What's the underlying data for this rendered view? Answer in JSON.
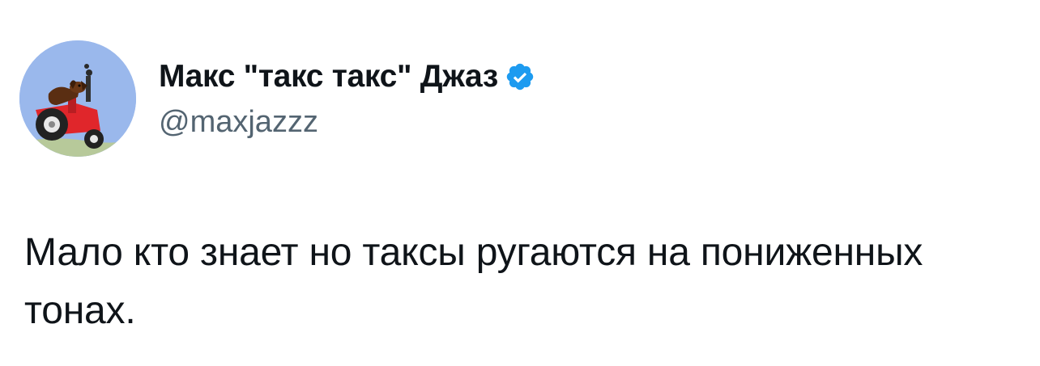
{
  "author": {
    "display_name": "Макс \"такс такс\" Джаз",
    "handle": "@maxjazzz",
    "verified": true,
    "verified_color": "#1d9bf0"
  },
  "avatar": {
    "icon": "dachshund-on-red-tractor-avatar",
    "background_color": "#9ab8ec"
  },
  "tweet": {
    "text": "Мало кто знает но таксы ругаются на пониженных тонах."
  }
}
